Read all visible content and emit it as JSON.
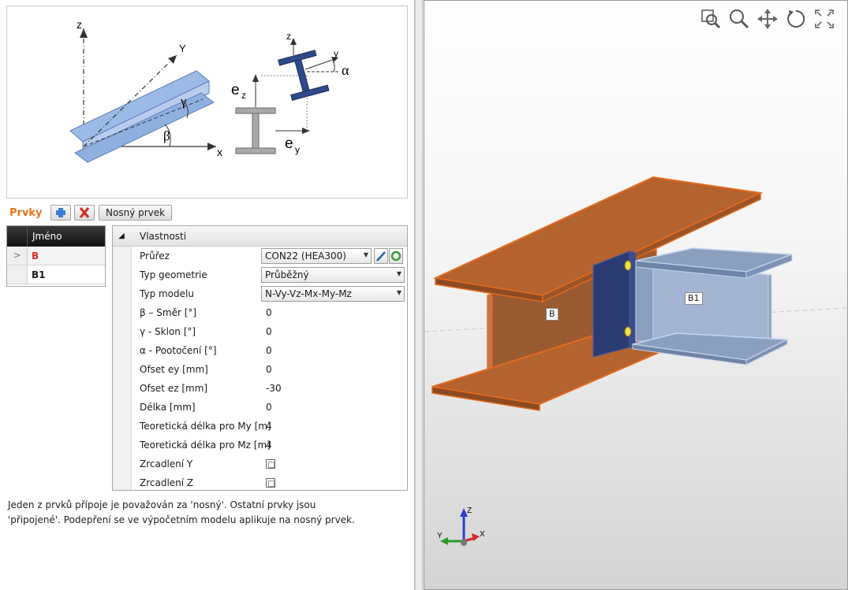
{
  "members": {
    "title": "Prvky",
    "carrier_button": "Nosný prvek",
    "add_icon": "add-icon",
    "delete_icon": "delete-icon"
  },
  "grid": {
    "column_name": "Jméno",
    "rows": [
      {
        "name": "B",
        "selected": true
      },
      {
        "name": "B1",
        "selected": false
      }
    ]
  },
  "properties": {
    "header": "Vlastnosti",
    "items": [
      {
        "label": "Průřez",
        "value": "CON22 (HEA300)"
      },
      {
        "label": "Typ geometrie",
        "value": "Průběžný"
      },
      {
        "label": "Typ modelu",
        "value": "N-Vy-Vz-Mx-My-Mz"
      },
      {
        "label": "β – Směr [°]",
        "value": "0"
      },
      {
        "label": "γ - Sklon [°]",
        "value": "0"
      },
      {
        "label": "α - Pootočení [°]",
        "value": "0"
      },
      {
        "label": "Ofset ey [mm]",
        "value": "0"
      },
      {
        "label": "Ofset ez [mm]",
        "value": "-30"
      },
      {
        "label": "Délka [mm]",
        "value": "0"
      },
      {
        "label": "Teoretická délka pro My [m]",
        "value": "4"
      },
      {
        "label": "Teoretická délka pro Mz [m]",
        "value": "4"
      },
      {
        "label": "Zrcadlení Y",
        "value": "unchecked"
      },
      {
        "label": "Zrcadlení Z",
        "value": "unchecked"
      }
    ]
  },
  "hint": {
    "line1": "Jeden z prvků přípoje je považován za 'nosný'. Ostatní prvky jsou",
    "line2": "'připojené'. Podepření se ve výpočetním modelu aplikuje na nosný prvek."
  },
  "diagram": {
    "axis_z": "z",
    "axis_y": "Y",
    "axis_x": "x",
    "gamma": "γ",
    "beta": "β",
    "axis_z_small": "z",
    "axis_y_small": "y",
    "alpha": "α",
    "ez": "e",
    "ez_sub": "z",
    "ey": "e",
    "ey_sub": "y"
  },
  "viewport": {
    "icons": [
      "zoom-window-icon",
      "zoom-icon",
      "pan-icon",
      "rotate-icon",
      "fit-icon"
    ],
    "label_b": "B",
    "label_b1": "B1",
    "axis_z": "Z",
    "axis_x": "X",
    "axis_y": "Y",
    "colors": {
      "beam_b": "#b4622e",
      "beam_b_edge": "#e36a1e",
      "beam_b1": "#8b9fbf",
      "beam_b1_edge": "#c6d6ee",
      "plate": "#2c3c72"
    }
  }
}
